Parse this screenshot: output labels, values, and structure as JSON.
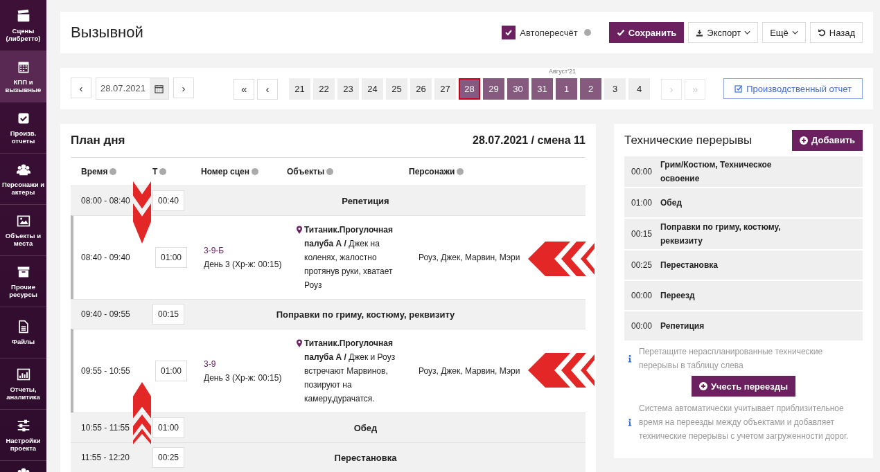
{
  "sidebar": {
    "items": [
      {
        "label": "Сцены (либретто)",
        "selected": false
      },
      {
        "label": "КПП и вызывные",
        "selected": true
      },
      {
        "label": "Произв. отчеты",
        "selected": false
      },
      {
        "label": "Персонажи и актеры",
        "selected": false
      },
      {
        "label": "Объекты и места",
        "selected": false
      },
      {
        "label": "Прочие ресурсы",
        "selected": false
      },
      {
        "label": "Файлы",
        "selected": false
      },
      {
        "label": "Отчеты, аналитика",
        "selected": false
      },
      {
        "label": "Настройки проекта",
        "selected": false
      }
    ]
  },
  "header": {
    "title": "Вызывной",
    "autorecalc": {
      "label": "Автопересчёт",
      "checked": true
    },
    "buttons": [
      {
        "kind": "primary",
        "label": "Сохранить"
      },
      {
        "kind": "export",
        "label": "Экспорт"
      },
      {
        "kind": "more",
        "label": "Ещё"
      },
      {
        "kind": "back",
        "label": "Назад"
      }
    ]
  },
  "date_nav": {
    "prev": "‹",
    "date": "28.07.2021",
    "next": "›",
    "first": "«",
    "back": "‹",
    "forward": "›",
    "last": "»",
    "month_label": "Август'21",
    "report_button": "Производственный отчет",
    "days": [
      {
        "label": "21",
        "filled": false,
        "selected": false
      },
      {
        "label": "22",
        "filled": false,
        "selected": false
      },
      {
        "label": "23",
        "filled": false,
        "selected": false
      },
      {
        "label": "24",
        "filled": false,
        "selected": false
      },
      {
        "label": "25",
        "filled": false,
        "selected": false
      },
      {
        "label": "26",
        "filled": false,
        "selected": false
      },
      {
        "label": "27",
        "filled": false,
        "selected": false
      },
      {
        "label": "28",
        "filled": true,
        "selected": true
      },
      {
        "label": "29",
        "filled": true,
        "selected": false
      },
      {
        "label": "30",
        "filled": true,
        "selected": false
      },
      {
        "label": "31",
        "filled": true,
        "selected": false
      },
      {
        "label": "1",
        "filled": true,
        "selected": false,
        "month_start": true
      },
      {
        "label": "2",
        "filled": true,
        "selected": false
      },
      {
        "label": "3",
        "filled": false,
        "selected": false
      },
      {
        "label": "4",
        "filled": false,
        "selected": false
      }
    ]
  },
  "day_plan": {
    "title": "План дня",
    "subtitle": "28.07.2021 / смена 11",
    "columns": [
      "Время",
      "Т",
      "Номер сцен",
      "Объекты",
      "Персонажи"
    ],
    "rows": [
      {
        "kind": "break",
        "time": "08:00 - 08:40",
        "duration": "00:40",
        "title": "Репетиция"
      },
      {
        "kind": "scene",
        "time": "08:40 - 09:40",
        "duration": "01:00",
        "scene": "3-9-Б",
        "day": "День 3 (Хр-ж: 00:15)",
        "object": "**Титаник.Прогулочная палуба А /** Джек на коленях, жалостно протянув руки, хватает Роуз",
        "characters": "Роуз, Джек, Марвин, Мэри"
      },
      {
        "kind": "break",
        "time": "09:40 - 09:55",
        "duration": "00:15",
        "title": "Поправки по гриму, костюму, реквизиту"
      },
      {
        "kind": "scene",
        "time": "09:55 - 10:55",
        "duration": "01:00",
        "scene": "3-9",
        "day": "День 3 (Хр-ж: 00:15)",
        "object": "**Титаник.Прогулочная палуба А /** Джек и Роуз встречают Марвинов, позируют на камеру,дурачатся.",
        "characters": "Роуз, Джек, Марвин, Мэри"
      },
      {
        "kind": "break",
        "time": "10:55 - 11:55",
        "duration": "01:00",
        "title": "Обед"
      },
      {
        "kind": "break",
        "time": "11:55 - 12:20",
        "duration": "00:25",
        "title": "Перестановка"
      }
    ]
  },
  "tech_breaks": {
    "title": "Технические перерывы",
    "add_button": "Добавить",
    "items": [
      {
        "time": "00:00",
        "title": "Грим/Костюм, Техническое освоение"
      },
      {
        "time": "01:00",
        "title": "Обед"
      },
      {
        "time": "00:15",
        "title": "Поправки по гриму, костюму, реквизиту"
      },
      {
        "time": "00:25",
        "title": "Перестановка"
      },
      {
        "time": "00:00",
        "title": "Переезд"
      },
      {
        "time": "00:00",
        "title": "Репетиция"
      }
    ],
    "hint": "Перетащите нераспланированные технические перерывы в таблицу слева",
    "travel_button": "Учесть переезды",
    "note": "Система автоматически учитывает приблизительное время на переезды между объектами и добавляет технические перерывы с учетом загруженности дорог."
  }
}
